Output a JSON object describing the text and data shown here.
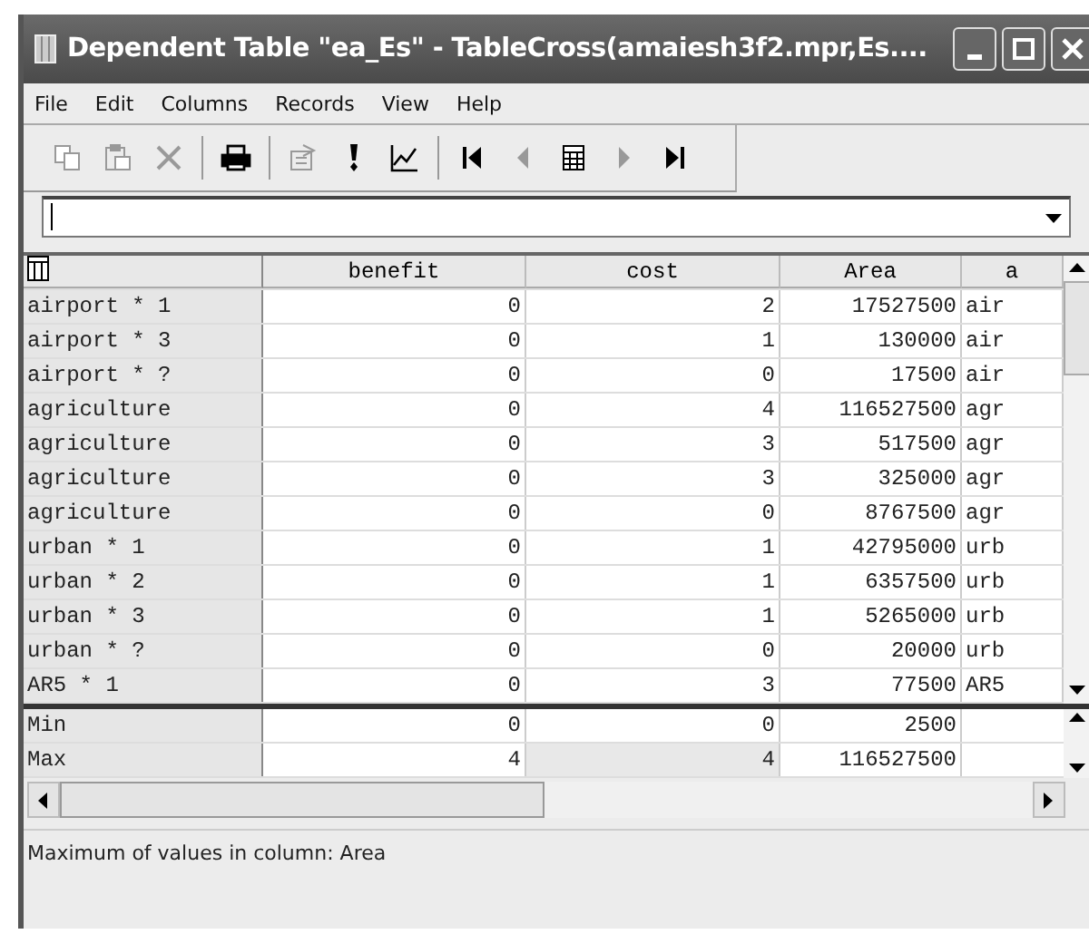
{
  "window": {
    "title": "Dependent Table \"ea_Es\" - TableCross(amaiesh3f2.mpr,Es...."
  },
  "menu": [
    {
      "label": "File"
    },
    {
      "label": "Edit"
    },
    {
      "label": "Columns"
    },
    {
      "label": "Records"
    },
    {
      "label": "View"
    },
    {
      "label": "Help"
    }
  ],
  "toolbar": [
    {
      "kind": "copy",
      "disabled": true
    },
    {
      "kind": "paste",
      "disabled": true
    },
    {
      "kind": "delete",
      "disabled": true
    },
    {
      "kind": "sep"
    },
    {
      "kind": "print",
      "disabled": false
    },
    {
      "kind": "sep"
    },
    {
      "kind": "properties",
      "disabled": true
    },
    {
      "kind": "exclaim",
      "disabled": false
    },
    {
      "kind": "graph",
      "disabled": false
    },
    {
      "kind": "sep"
    },
    {
      "kind": "first",
      "disabled": false
    },
    {
      "kind": "prev",
      "disabled": true
    },
    {
      "kind": "table",
      "disabled": false
    },
    {
      "kind": "next",
      "disabled": true
    },
    {
      "kind": "last",
      "disabled": false
    }
  ],
  "table": {
    "columns": [
      "benefit",
      "cost",
      "Area",
      "a"
    ],
    "rows": [
      {
        "label": "airport * 1",
        "cells": [
          "0",
          "2",
          "17527500",
          "air"
        ]
      },
      {
        "label": "airport * 3",
        "cells": [
          "0",
          "1",
          "130000",
          "air"
        ]
      },
      {
        "label": "airport * ?",
        "cells": [
          "0",
          "0",
          "17500",
          "air"
        ]
      },
      {
        "label": "agriculture",
        "cells": [
          "0",
          "4",
          "116527500",
          "agr"
        ]
      },
      {
        "label": "agriculture",
        "cells": [
          "0",
          "3",
          "517500",
          "agr"
        ]
      },
      {
        "label": "agriculture",
        "cells": [
          "0",
          "3",
          "325000",
          "agr"
        ]
      },
      {
        "label": "agriculture",
        "cells": [
          "0",
          "0",
          "8767500",
          "agr"
        ]
      },
      {
        "label": "urban * 1",
        "cells": [
          "0",
          "1",
          "42795000",
          "urb"
        ]
      },
      {
        "label": "urban * 2",
        "cells": [
          "0",
          "1",
          "6357500",
          "urb"
        ]
      },
      {
        "label": "urban * 3",
        "cells": [
          "0",
          "1",
          "5265000",
          "urb"
        ]
      },
      {
        "label": "urban * ?",
        "cells": [
          "0",
          "0",
          "20000",
          "urb"
        ]
      },
      {
        "label": "AR5 * 1",
        "cells": [
          "0",
          "3",
          "77500",
          "AR5"
        ]
      }
    ],
    "footer_rows": [
      {
        "label": "Min",
        "cells": [
          {
            "text": "0",
            "selected": false
          },
          {
            "text": "0",
            "selected": false
          },
          {
            "text": "2500",
            "selected": false
          }
        ]
      },
      {
        "label": "Max",
        "cells": [
          {
            "text": "4",
            "selected": false
          },
          {
            "text": "4",
            "selected": true
          },
          {
            "text": "116527500",
            "selected": false
          }
        ]
      }
    ]
  },
  "status_bar": "Maximum of values in column: Area"
}
